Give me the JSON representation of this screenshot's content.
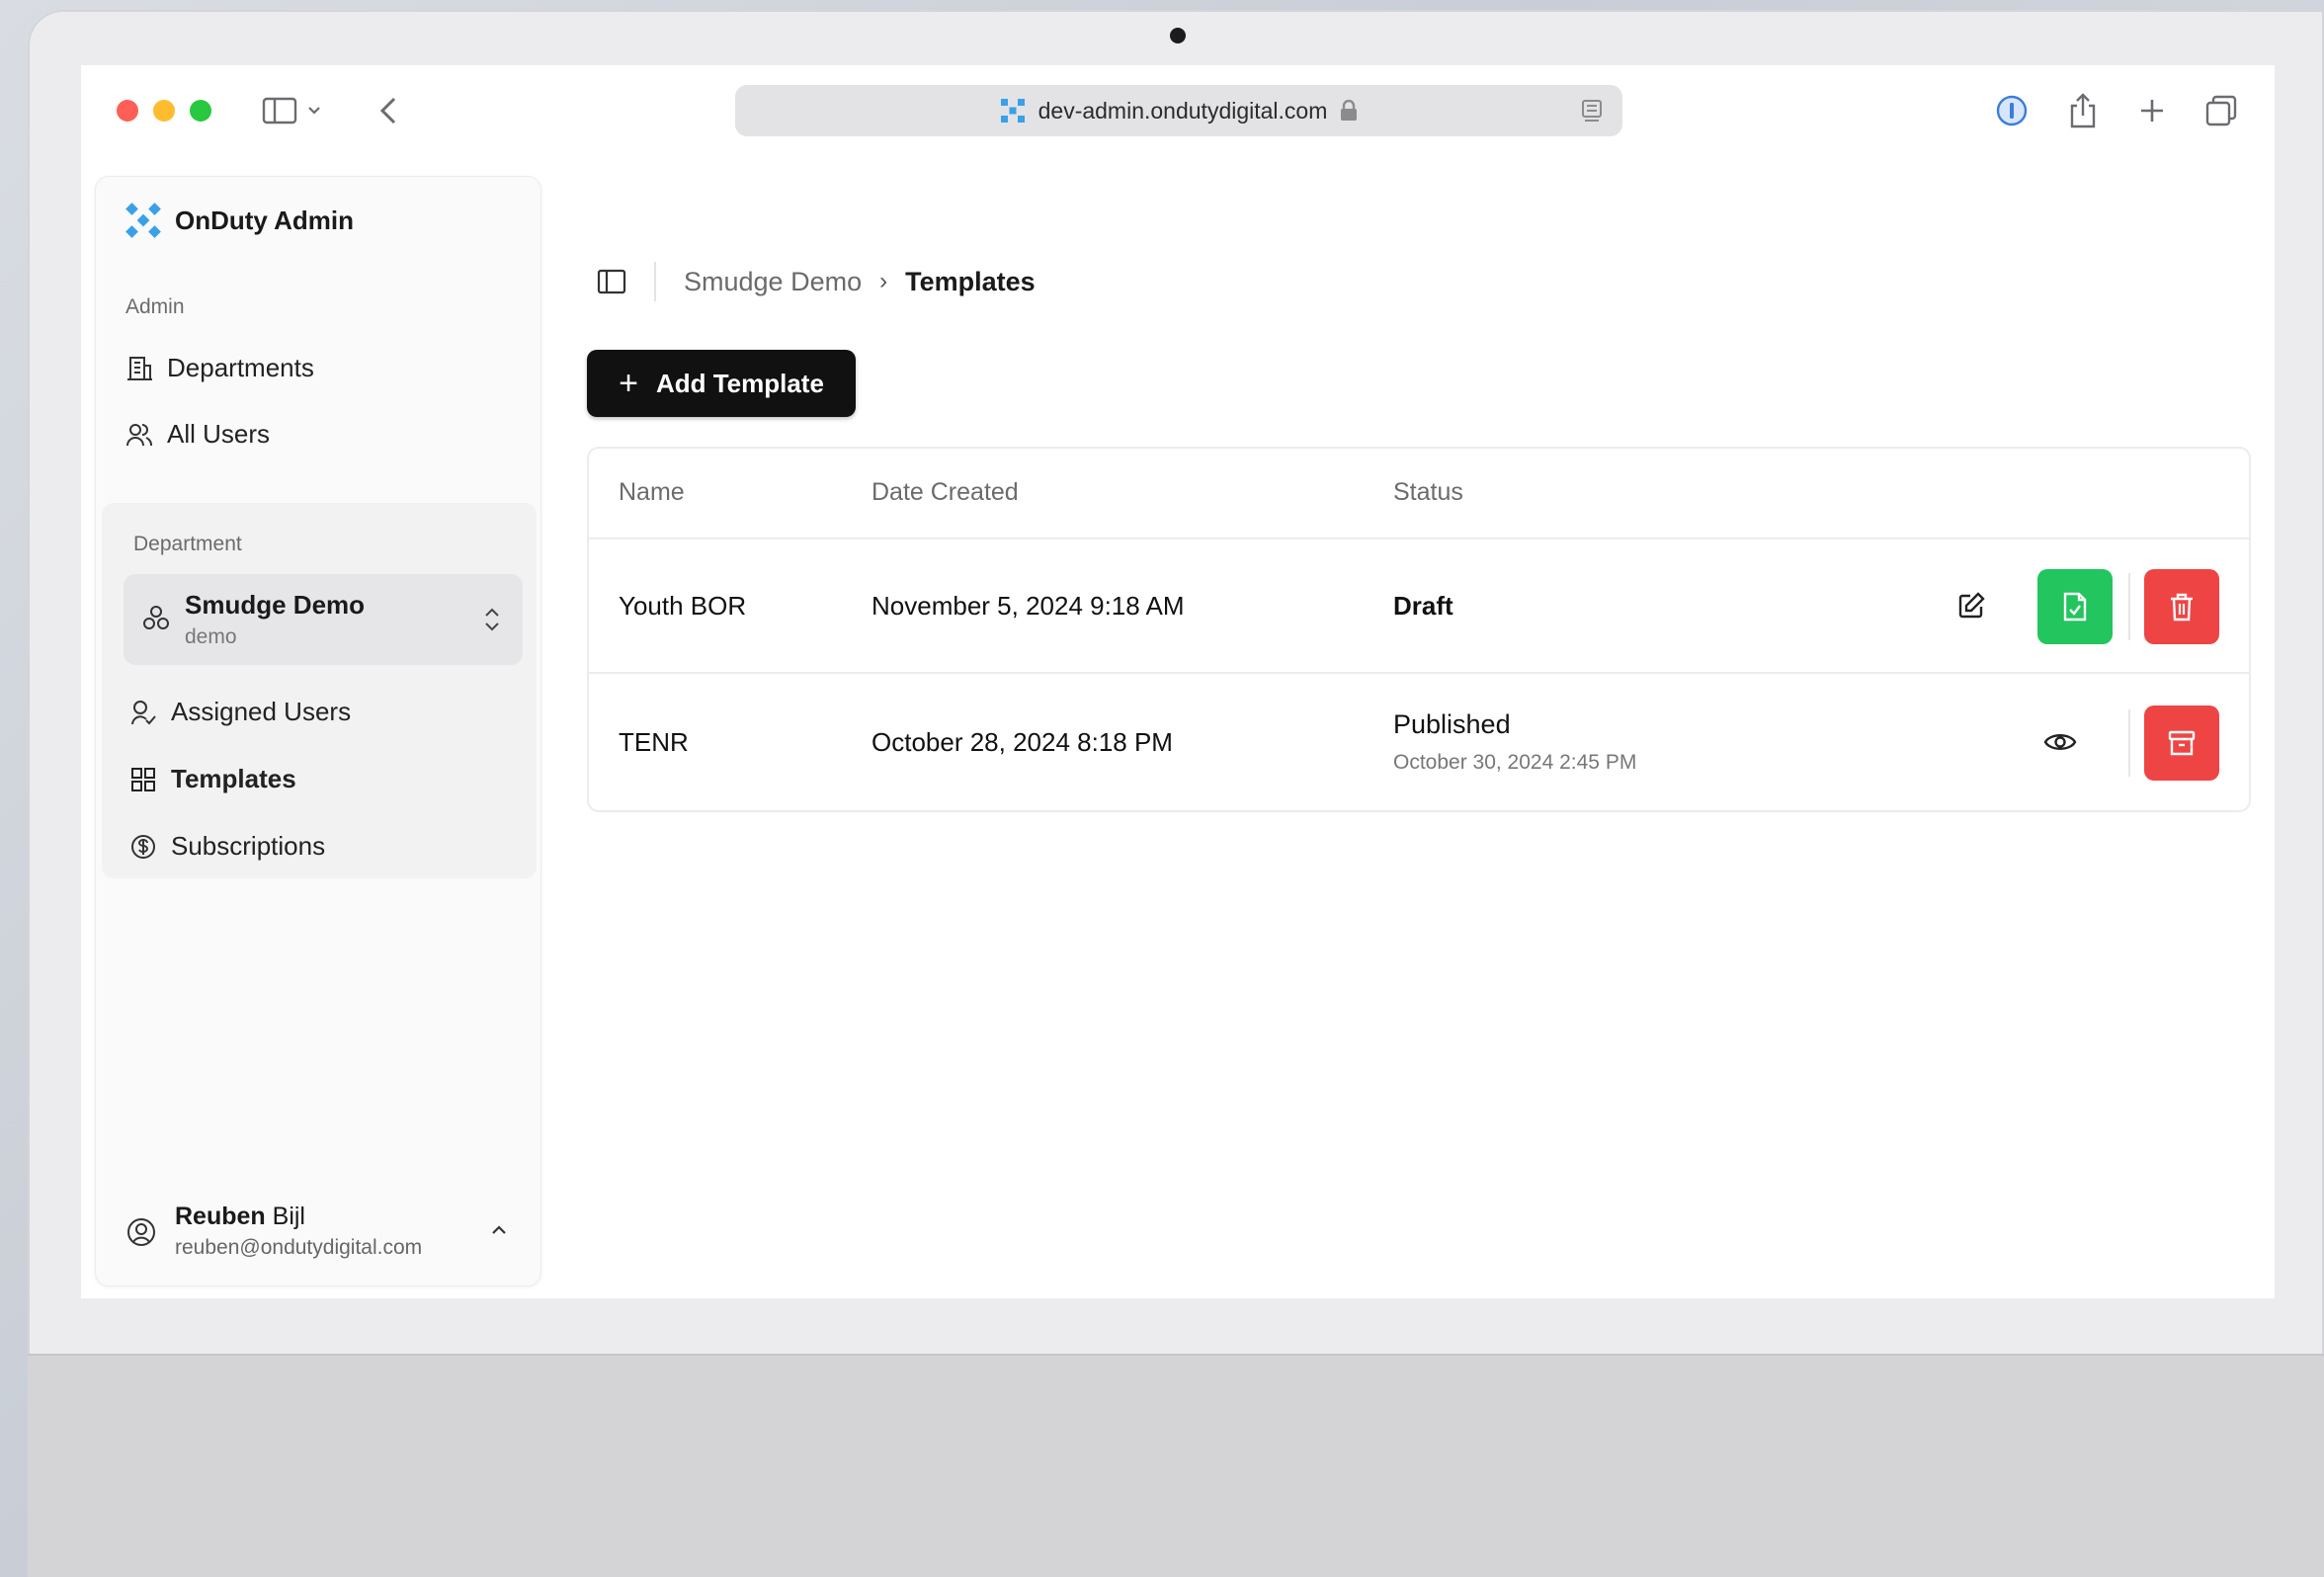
{
  "browser": {
    "url": "dev-admin.ondutydigital.com"
  },
  "sidebar": {
    "brand": "OnDuty Admin",
    "admin_section": "Admin",
    "admin_items": [
      {
        "label": "Departments",
        "icon": "building-icon"
      },
      {
        "label": "All Users",
        "icon": "users-icon"
      }
    ],
    "department_section": "Department",
    "department": {
      "name": "Smudge Demo",
      "slug": "demo"
    },
    "department_items": [
      {
        "label": "Assigned Users",
        "icon": "user-check-icon"
      },
      {
        "label": "Templates",
        "icon": "layout-grid-icon",
        "active": true
      },
      {
        "label": "Subscriptions",
        "icon": "badge-dollar-icon"
      }
    ],
    "user": {
      "first": "Reuben",
      "last": "Bijl",
      "email": "reuben@ondutydigital.com"
    }
  },
  "main": {
    "breadcrumb": [
      "Smudge Demo",
      "Templates"
    ],
    "add_button": "Add Template",
    "table": {
      "columns": [
        "Name",
        "Date Created",
        "Status"
      ],
      "rows": [
        {
          "name": "Youth BOR",
          "date": "November 5, 2024 9:18 AM",
          "status": "Draft",
          "status_detail": ""
        },
        {
          "name": "TENR",
          "date": "October 28, 2024 8:18 PM",
          "status": "Published",
          "status_detail": "October 30, 2024 2:45 PM"
        }
      ]
    }
  },
  "colors": {
    "publish_green": "#22c55e",
    "danger_red": "#ef4444",
    "primary_black": "#111111"
  }
}
